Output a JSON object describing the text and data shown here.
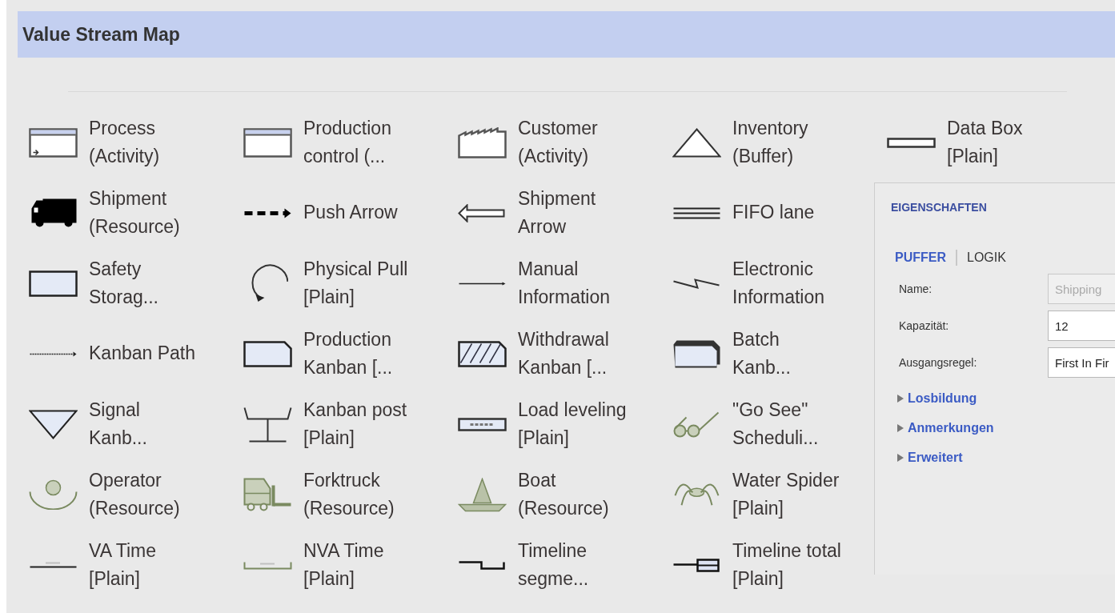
{
  "title": "Value Stream Map",
  "shapes": [
    {
      "lines": [
        "Process",
        "(Activity)"
      ]
    },
    {
      "lines": [
        "Production",
        "control (..."
      ]
    },
    {
      "lines": [
        "Customer",
        "(Activity)"
      ]
    },
    {
      "lines": [
        "Inventory",
        "(Buffer)"
      ]
    },
    {
      "lines": [
        "Data Box",
        "[Plain]"
      ]
    },
    {
      "lines": [
        "Shipment",
        "(Resource)"
      ]
    },
    {
      "lines": [
        "Push Arrow"
      ]
    },
    {
      "lines": [
        "Shipment",
        "Arrow"
      ]
    },
    {
      "lines": [
        "FIFO lane"
      ]
    },
    {
      "lines": [
        "Safety",
        "Storag..."
      ]
    },
    {
      "lines": [
        "Physical Pull",
        "[Plain]"
      ]
    },
    {
      "lines": [
        "Manual",
        "Information"
      ]
    },
    {
      "lines": [
        "Electronic",
        "Information"
      ]
    },
    {
      "lines": [
        "Kanban Path"
      ]
    },
    {
      "lines": [
        "Production",
        "Kanban [..."
      ]
    },
    {
      "lines": [
        "Withdrawal",
        "Kanban [..."
      ]
    },
    {
      "lines": [
        "Batch",
        "Kanb..."
      ]
    },
    {
      "lines": [
        "Signal",
        "Kanb..."
      ]
    },
    {
      "lines": [
        "Kanban post",
        "[Plain]"
      ]
    },
    {
      "lines": [
        "Load leveling",
        "[Plain]"
      ]
    },
    {
      "lines": [
        "\"Go See\"",
        "Scheduli..."
      ]
    },
    {
      "lines": [
        "Operator",
        "(Resource)"
      ]
    },
    {
      "lines": [
        "Forktruck",
        "(Resource)"
      ]
    },
    {
      "lines": [
        "Boat",
        "(Resource)"
      ]
    },
    {
      "lines": [
        "Water Spider",
        "[Plain]"
      ]
    },
    {
      "lines": [
        "VA Time",
        "[Plain]"
      ]
    },
    {
      "lines": [
        "NVA Time",
        "[Plain]"
      ]
    },
    {
      "lines": [
        "Timeline",
        "segme..."
      ]
    },
    {
      "lines": [
        "Timeline total",
        "[Plain]"
      ]
    }
  ],
  "properties": {
    "title": "EIGENSCHAFTEN",
    "tabs": [
      {
        "label": "PUFFER",
        "selected": true
      },
      {
        "label": "LOGIK",
        "selected": false
      }
    ],
    "fields": [
      {
        "label": "Name:",
        "value": "Shipping",
        "disabled": true
      },
      {
        "label": "Kapazität:",
        "value": "12",
        "disabled": false
      },
      {
        "label": "Ausgangsregel:",
        "value": "First In Fir",
        "disabled": false
      }
    ],
    "sections": [
      {
        "label": "Losbildung",
        "expanded": false
      },
      {
        "label": "Anmerkungen",
        "expanded": false
      },
      {
        "label": "Erweitert",
        "expanded": false
      }
    ]
  }
}
